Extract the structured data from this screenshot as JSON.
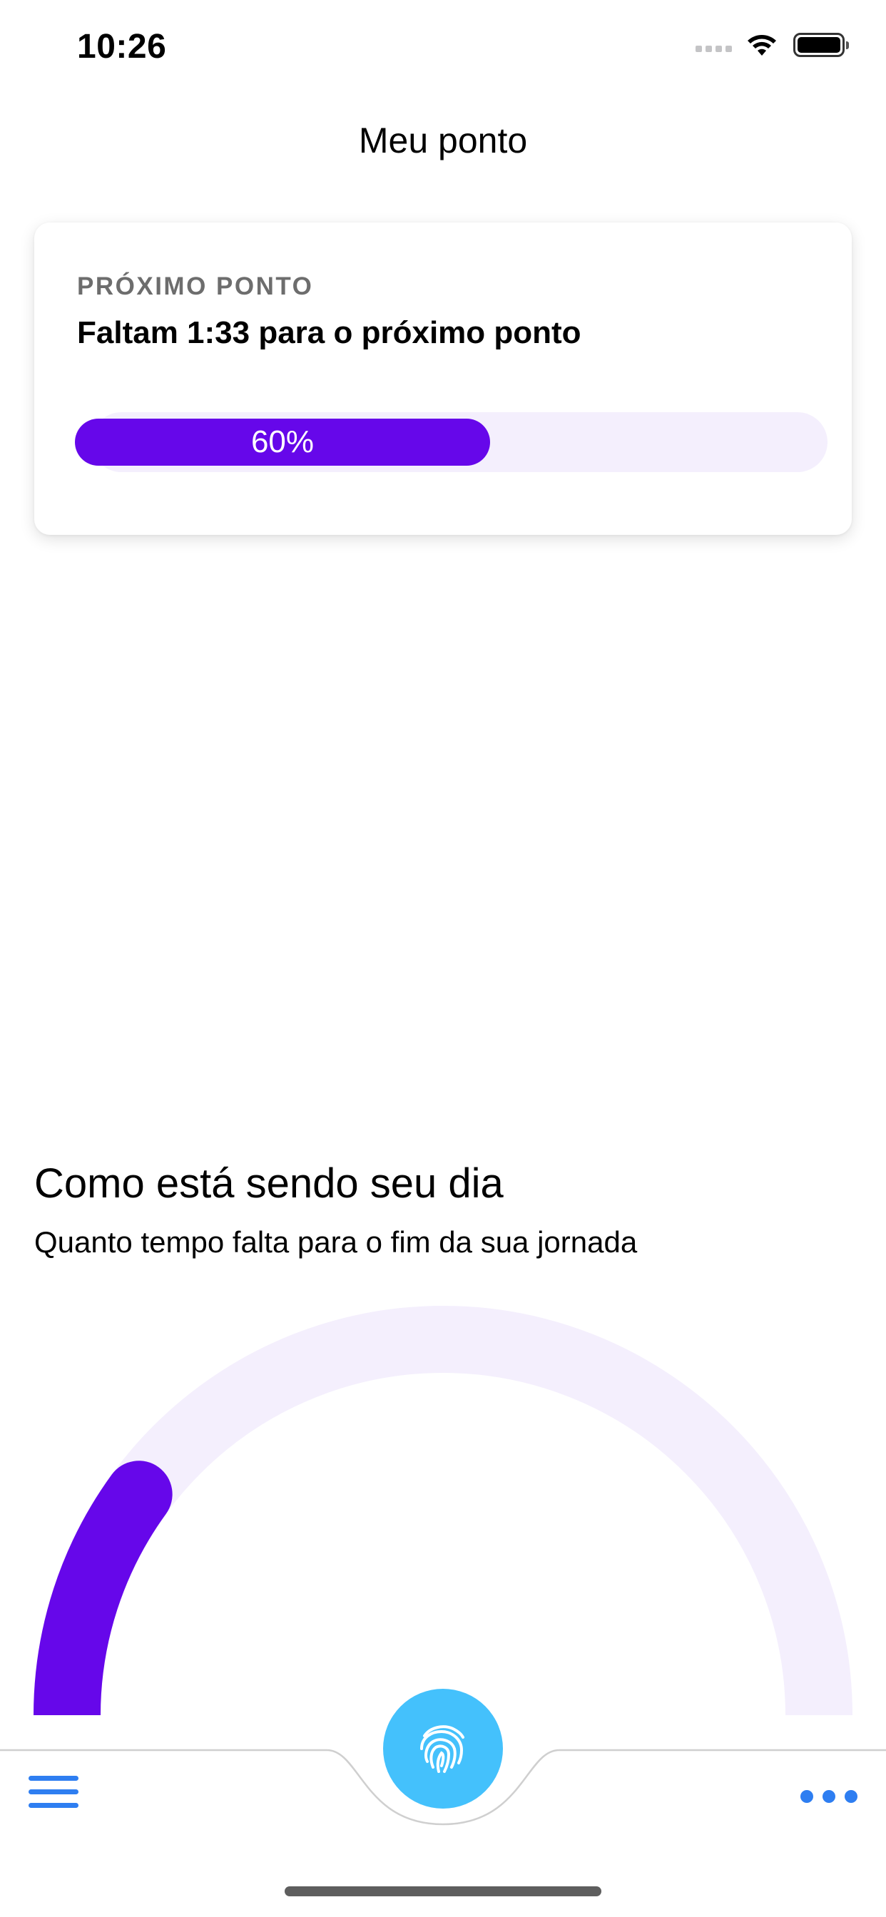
{
  "status_bar": {
    "time": "10:26"
  },
  "header": {
    "title": "Meu ponto"
  },
  "next_punch_card": {
    "eyebrow": "PRÓXIMO PONTO",
    "title": "Faltam 1:33 para o próximo ponto",
    "progress_label": "60%",
    "progress_value": 0.6
  },
  "day_section": {
    "title": "Como está sendo seu dia",
    "subtitle": "Quanto tempo falta para o fim da sua jornada",
    "gauge_progress": 0.2
  },
  "tab_bar": {
    "left_icon": "menu-icon",
    "center_icon": "fingerprint-icon",
    "right_icon": "more-icon"
  },
  "colors": {
    "accent_purple": "#6607EA",
    "track_lavender": "#F4EFFD",
    "fab_blue": "#44C1FC",
    "tab_icon_blue": "#2E7EF1"
  }
}
